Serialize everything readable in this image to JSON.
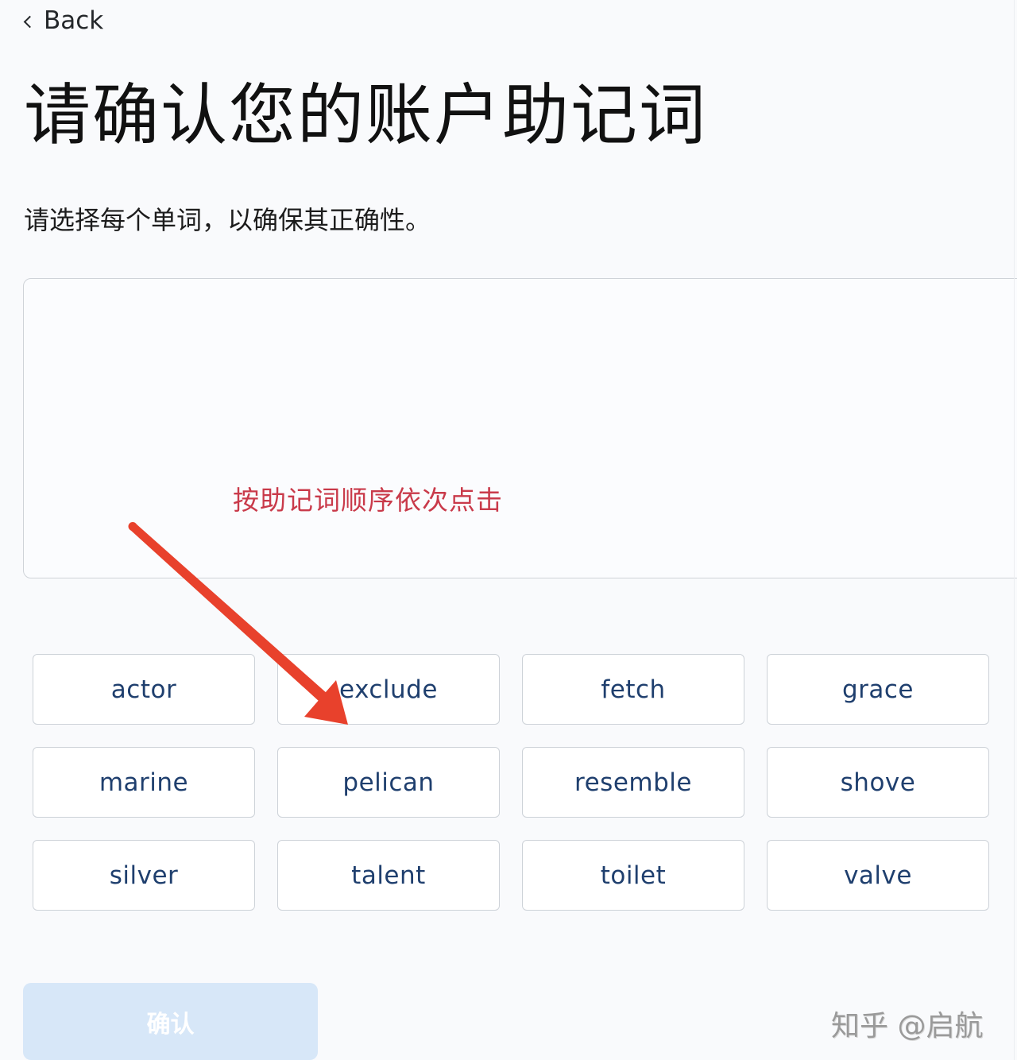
{
  "nav": {
    "back_label": "Back",
    "back_icon": "chevron-left-icon"
  },
  "header": {
    "title": "请确认您的账户助记词",
    "subtitle": "请选择每个单词，以确保其正确性。"
  },
  "phrase_box": {
    "hint": "按助记词顺序依次点击",
    "hint_color": "#c93a4a"
  },
  "words": [
    "actor",
    "exclude",
    "fetch",
    "grace",
    "marine",
    "pelican",
    "resemble",
    "shove",
    "silver",
    "talent",
    "toilet",
    "valve"
  ],
  "confirm": {
    "label": "确认",
    "state": "disabled",
    "color": "#d7e7f8"
  },
  "annotation": {
    "type": "red-arrow",
    "color": "#e8412c"
  },
  "watermark": "知乎 @启航"
}
